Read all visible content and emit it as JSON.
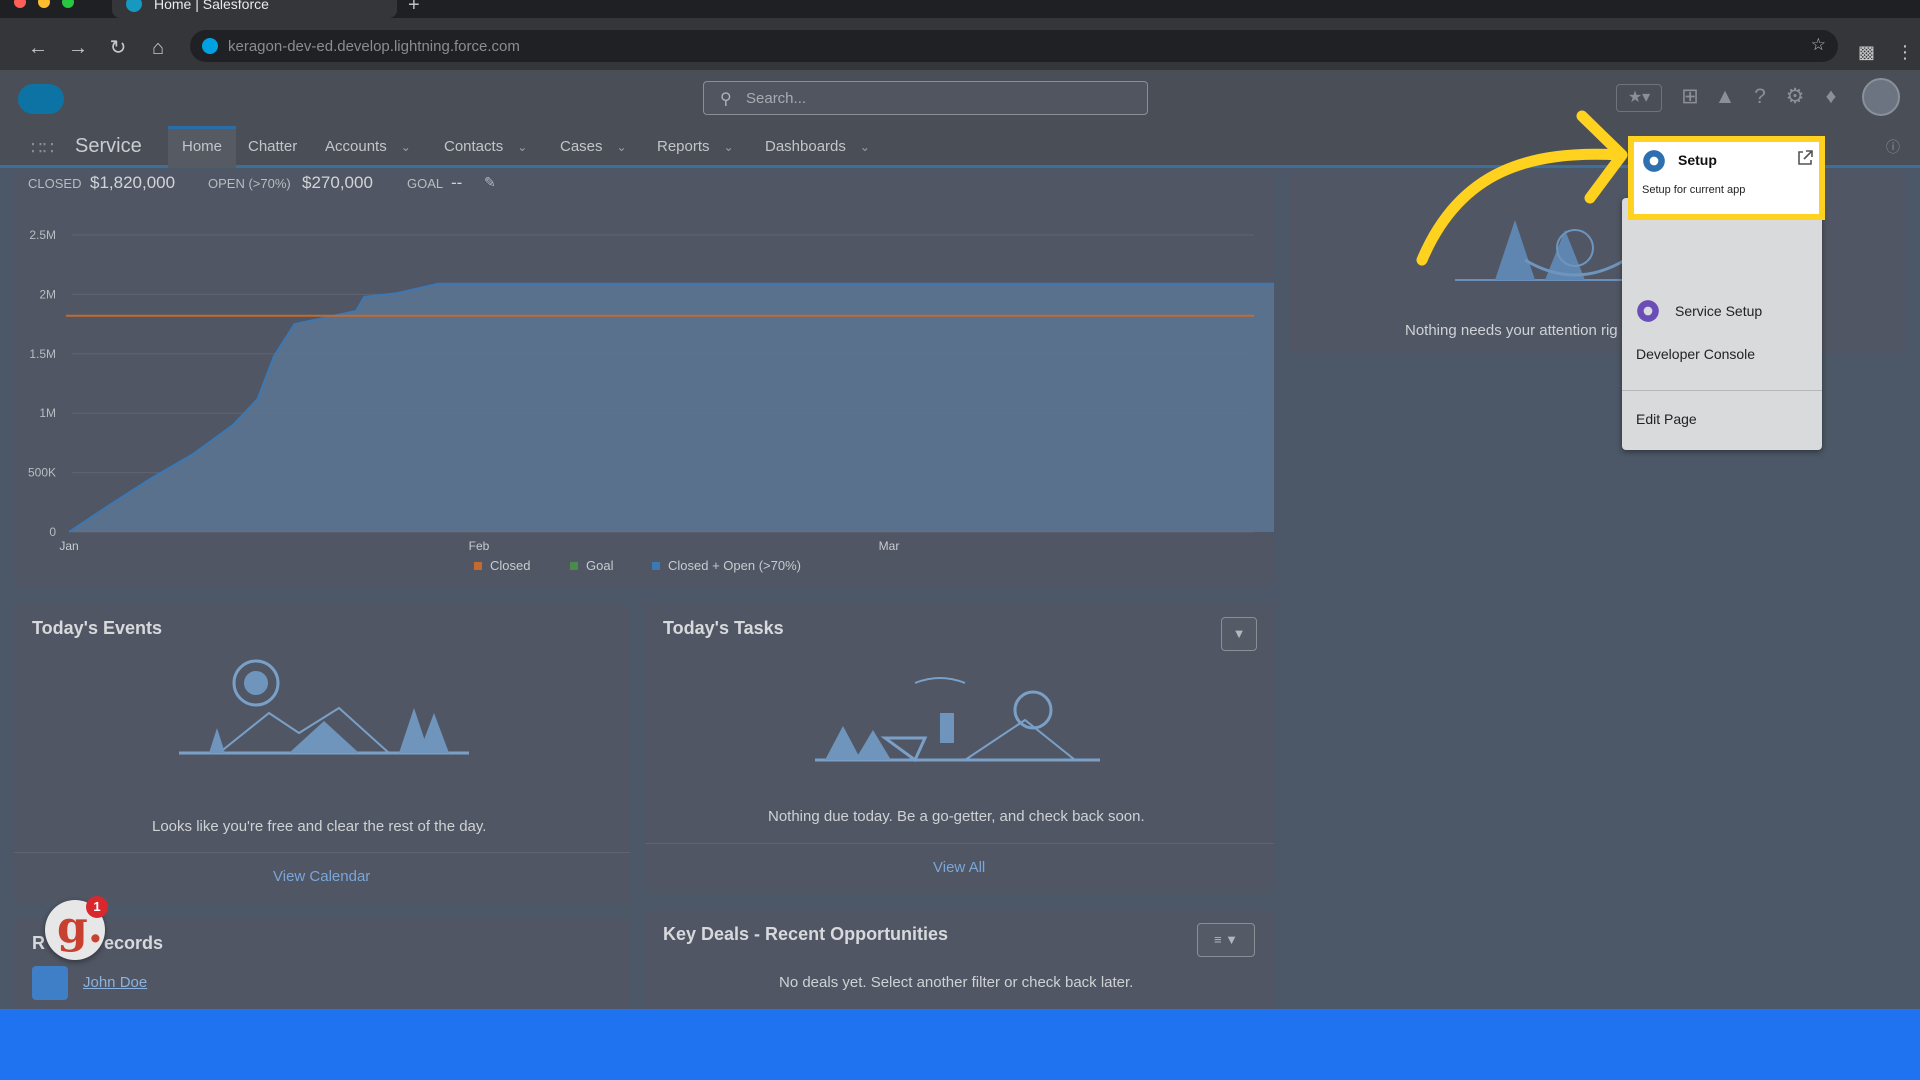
{
  "browser": {
    "tab_title": "Home | Salesforce",
    "url": "keragon-dev-ed.develop.lightning.force.com"
  },
  "header": {
    "search_placeholder": "Search..."
  },
  "nav": {
    "app_name": "Service",
    "items": [
      {
        "label": "Home",
        "active": true,
        "has_menu": false
      },
      {
        "label": "Chatter",
        "active": false,
        "has_menu": false
      },
      {
        "label": "Accounts",
        "active": false,
        "has_menu": true
      },
      {
        "label": "Contacts",
        "active": false,
        "has_menu": true
      },
      {
        "label": "Cases",
        "active": false,
        "has_menu": true
      },
      {
        "label": "Reports",
        "active": false,
        "has_menu": true
      },
      {
        "label": "Dashboards",
        "active": false,
        "has_menu": true
      }
    ]
  },
  "stats": {
    "closed_label": "CLOSED",
    "closed_value": "$1,820,000",
    "open_label": "OPEN (>70%)",
    "open_value": "$270,000",
    "goal_label": "GOAL",
    "goal_value": "--"
  },
  "chart_data": {
    "type": "line",
    "x_ticks": [
      "Jan",
      "Feb",
      "Mar"
    ],
    "y_ticks": [
      "0",
      "500K",
      "1M",
      "1.5M",
      "2M",
      "2.5M"
    ],
    "ylim": [
      0,
      2500000
    ],
    "legend": [
      "Closed",
      "Goal",
      "Closed + Open (>70%)"
    ],
    "legend_position": "bottom",
    "colors": {
      "closed": "#c46a2e",
      "goal": "#4a8a4a",
      "closed_open": "#3c78b4"
    },
    "closed_level": 1820000,
    "series_closed_open": [
      [
        0,
        0
      ],
      [
        0.1,
        230000
      ],
      [
        0.2,
        450000
      ],
      [
        0.3,
        650000
      ],
      [
        0.4,
        900000
      ],
      [
        0.46,
        1120000
      ],
      [
        0.5,
        1480000
      ],
      [
        0.55,
        1750000
      ],
      [
        0.7,
        1860000
      ],
      [
        0.72,
        1980000
      ],
      [
        0.8,
        2010000
      ],
      [
        0.9,
        2090000
      ],
      [
        1.0,
        2090000
      ],
      [
        1.5,
        2090000
      ],
      [
        2.0,
        2090000
      ],
      [
        2.95,
        2090000
      ]
    ]
  },
  "events_card": {
    "title": "Today's Events",
    "message": "Looks like you're free and clear the rest of the day.",
    "link": "View Calendar"
  },
  "tasks_card": {
    "title": "Today's Tasks",
    "message": "Nothing due today. Be a go-getter, and check back soon.",
    "link": "View All"
  },
  "right_card": {
    "message": "Nothing needs your attention rig"
  },
  "recent_records": {
    "title_prefix": "R",
    "title_suffix": "ecords",
    "record": "John Doe"
  },
  "key_deals": {
    "title": "Key Deals - Recent Opportunities",
    "message": "No deals yet. Select another filter or check back later."
  },
  "setup_menu": {
    "setup_label": "Setup",
    "setup_sub": "Setup for current app",
    "service_setup": "Service Setup",
    "developer_console": "Developer Console",
    "edit_page": "Edit Page"
  },
  "badge": {
    "letter": "g.",
    "count": "1"
  }
}
